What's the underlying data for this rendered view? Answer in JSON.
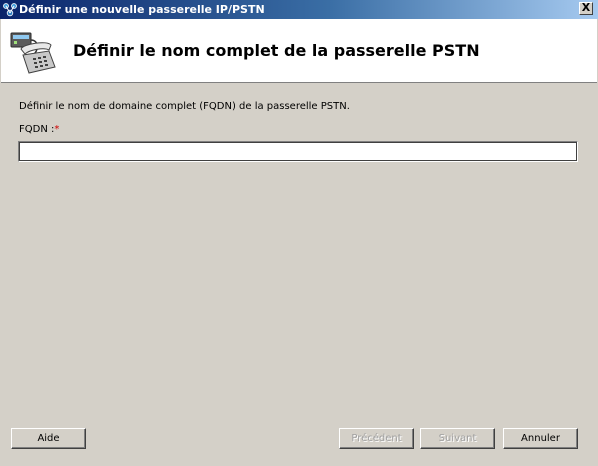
{
  "window": {
    "title": "Définir une nouvelle passerelle IP/PSTN",
    "close_label": "X"
  },
  "header": {
    "title": "Définir le nom complet de la passerelle PSTN",
    "icon": "phone-gateway-icon"
  },
  "form": {
    "description": "Définir le nom de domaine complet (FQDN) de la passerelle PSTN.",
    "fqdn_label": "FQDN :",
    "required_mark": "*",
    "fqdn_value": ""
  },
  "buttons": {
    "help": "Aide",
    "previous": "Précédent",
    "next": "Suivant",
    "cancel": "Annuler"
  },
  "colors": {
    "titlebar_start": "#0a246a",
    "titlebar_end": "#a6caf0",
    "dialog_background": "#d4d0c8",
    "required_mark": "#d00000"
  }
}
